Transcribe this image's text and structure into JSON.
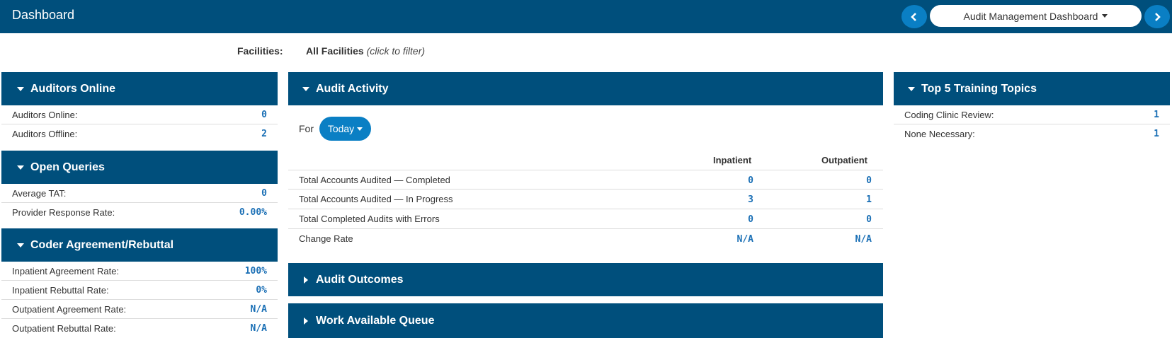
{
  "header": {
    "title": "Dashboard",
    "dashboard_select": "Audit Management Dashboard"
  },
  "filter": {
    "label": "Facilities:",
    "value": "All Facilities",
    "hint": "(click to filter)"
  },
  "auditors_online": {
    "title": "Auditors Online",
    "rows": [
      {
        "label": "Auditors Online:",
        "value": "0"
      },
      {
        "label": "Auditors Offline:",
        "value": "2"
      }
    ]
  },
  "open_queries": {
    "title": "Open Queries",
    "rows": [
      {
        "label": "Average TAT:",
        "value": "0"
      },
      {
        "label": "Provider Response Rate:",
        "value": "0.00%"
      }
    ]
  },
  "coder_agreement": {
    "title": "Coder Agreement/Rebuttal",
    "rows": [
      {
        "label": "Inpatient Agreement Rate:",
        "value": "100%"
      },
      {
        "label": "Inpatient Rebuttal Rate:",
        "value": "0%"
      },
      {
        "label": "Outpatient Agreement Rate:",
        "value": "N/A"
      },
      {
        "label": "Outpatient Rebuttal Rate:",
        "value": "N/A"
      }
    ]
  },
  "audit_activity": {
    "title": "Audit Activity",
    "for_label": "For",
    "period": "Today",
    "columns": [
      "Inpatient",
      "Outpatient"
    ],
    "rows": [
      {
        "label": "Total Accounts Audited — Completed",
        "inpatient": "0",
        "outpatient": "0"
      },
      {
        "label": "Total Accounts Audited — In Progress",
        "inpatient": "3",
        "outpatient": "1"
      },
      {
        "label": "Total Completed Audits with Errors",
        "inpatient": "0",
        "outpatient": "0"
      },
      {
        "label": "Change Rate",
        "inpatient": "N/A",
        "outpatient": "N/A"
      }
    ]
  },
  "audit_outcomes": {
    "title": "Audit Outcomes"
  },
  "work_queue": {
    "title": "Work Available Queue"
  },
  "training_topics": {
    "title": "Top 5 Training Topics",
    "rows": [
      {
        "label": "Coding Clinic Review:",
        "value": "1"
      },
      {
        "label": "None Necessary:",
        "value": "1"
      }
    ]
  },
  "colors": {
    "header_bg": "#004f7c",
    "accent_button": "#0a7fc4",
    "value_text": "#1a6fb5"
  },
  "icons": [
    "chevron-left-icon",
    "chevron-right-icon",
    "caret-down-icon",
    "triangle-down-icon",
    "triangle-right-icon"
  ]
}
